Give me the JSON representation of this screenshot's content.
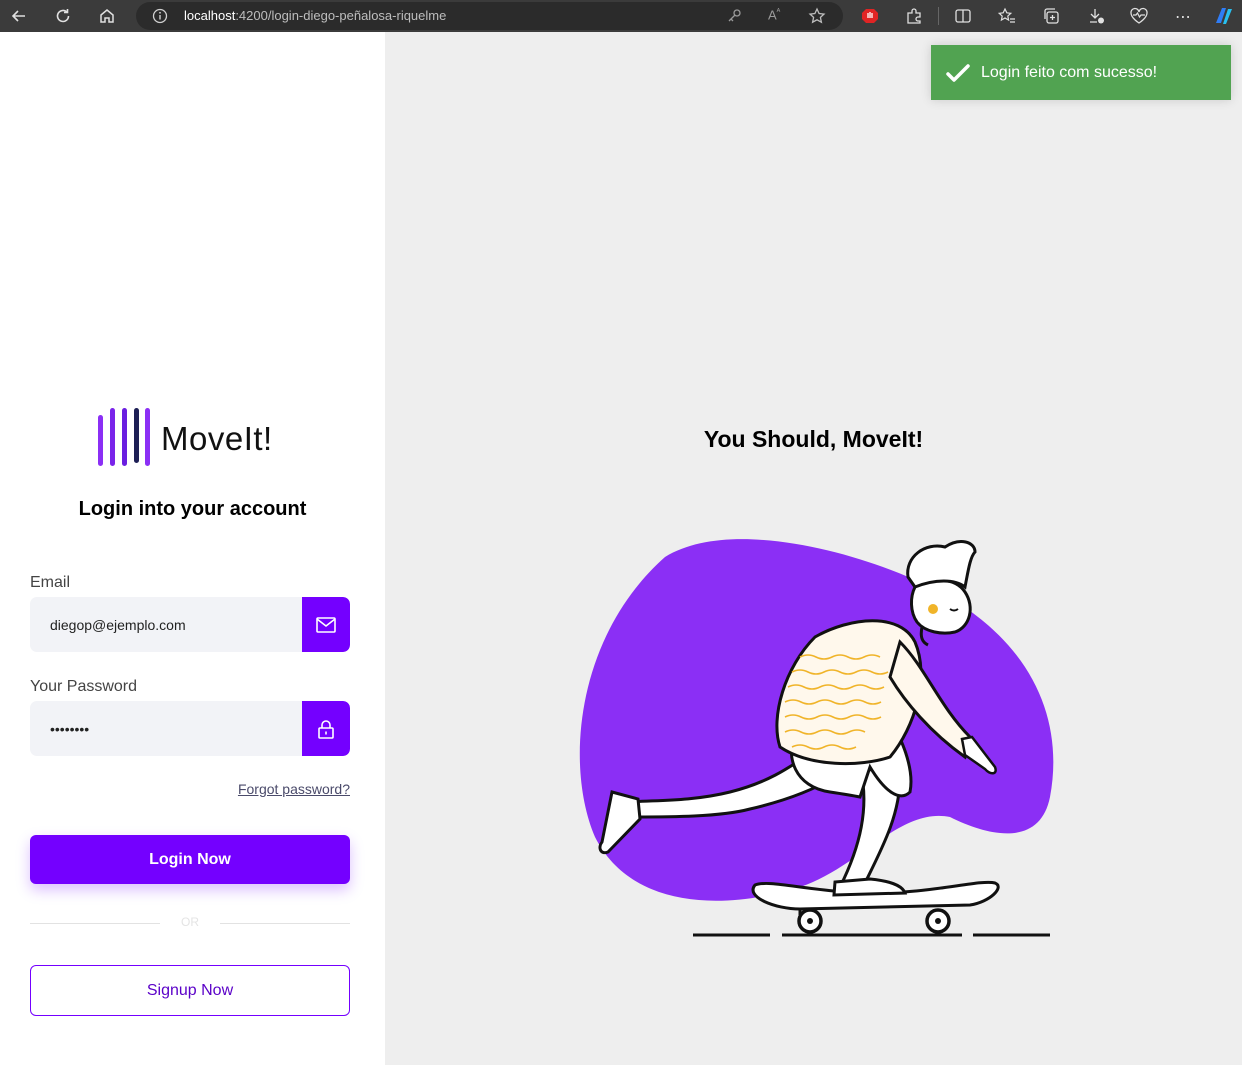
{
  "browser": {
    "url_host": "localhost",
    "url_path": ":4200/login-diego-peñalosa-riquelme"
  },
  "brand": {
    "name": "MoveIt!",
    "accent_color": "#7400ff",
    "blob_color": "#8b2ff5"
  },
  "login": {
    "title": "Login into your account",
    "email_label": "Email",
    "email_value": "diegop@ejemplo.com",
    "password_label": "Your Password",
    "password_value": "password",
    "forgot_label": "Forgot password?",
    "login_label": "Login Now",
    "or_label": "OR",
    "signup_label": "Signup Now"
  },
  "hero": {
    "tagline": "You Should, MoveIt!"
  },
  "toast": {
    "message": "Login feito com sucesso!",
    "color": "#51a351"
  }
}
